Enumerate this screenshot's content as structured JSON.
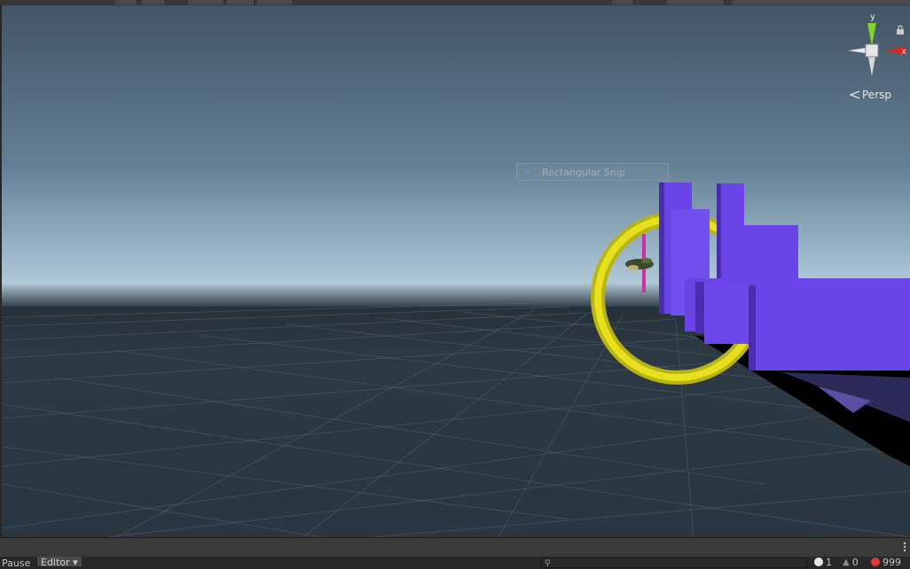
{
  "scene_view": {
    "overlay": {
      "rectangular_snip_label": "Rectangular Snip"
    },
    "gizmo": {
      "y_axis_label": "y",
      "x_axis_label": "x",
      "projection_label": "Persp"
    }
  },
  "status_bar": {
    "pause_label": "Pause",
    "editor_dropdown_label": "Editor",
    "log_count": "1",
    "warning_count": "0",
    "error_count": "999"
  },
  "colors": {
    "sky_top": "#435465",
    "horizon": "#b8cfdd",
    "ground": "#2c3944",
    "purple_blocks": "#6a44e6",
    "yellow_ring": "#e6e01e",
    "gizmo_x": "#e02020",
    "gizmo_y": "#7cd42a",
    "error_red": "#d83b3b"
  }
}
